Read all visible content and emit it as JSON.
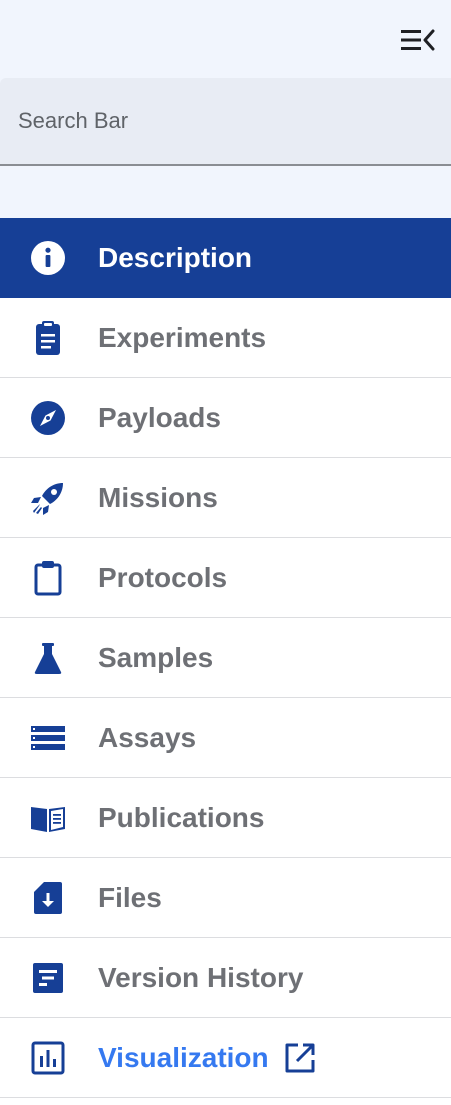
{
  "search": {
    "placeholder": "Search Bar"
  },
  "colors": {
    "active_bg": "#163f96",
    "icon": "#163f96",
    "label": "#6e7075",
    "link": "#3579f0",
    "top_bg": "#f1f5fd",
    "search_bg": "#e8ecf4"
  },
  "nav": {
    "items": [
      {
        "label": "Description",
        "icon": "info-icon",
        "active": true
      },
      {
        "label": "Experiments",
        "icon": "clipboard-list-icon"
      },
      {
        "label": "Payloads",
        "icon": "compass-icon"
      },
      {
        "label": "Missions",
        "icon": "rocket-icon"
      },
      {
        "label": "Protocols",
        "icon": "clipboard-icon"
      },
      {
        "label": "Samples",
        "icon": "flask-icon"
      },
      {
        "label": "Assays",
        "icon": "list-icon"
      },
      {
        "label": "Publications",
        "icon": "book-icon"
      },
      {
        "label": "Files",
        "icon": "file-download-icon"
      },
      {
        "label": "Version History",
        "icon": "document-lines-icon"
      },
      {
        "label": "Visualization",
        "icon": "bar-chart-icon",
        "external": true,
        "external_icon": "external-link-icon"
      }
    ]
  }
}
